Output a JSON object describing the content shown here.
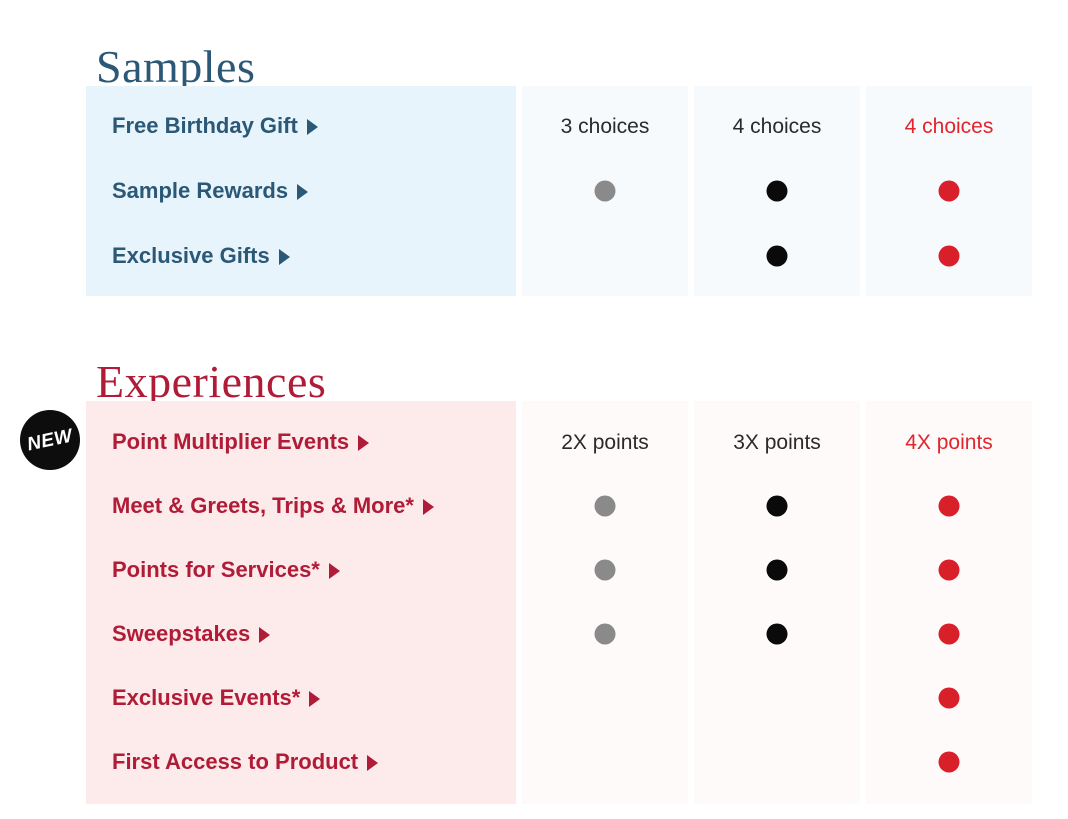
{
  "colors": {
    "samples_accent": "#2a5876",
    "experiences_accent": "#b01c37",
    "samples_label_bg": "#e8f4fb",
    "samples_data_bg": "#f6fafd",
    "experiences_label_bg": "#fdeaea",
    "experiences_data_bg": "#fdfaf9",
    "dot_grey": "#8a8a8a",
    "dot_black": "#0a0a0a",
    "dot_red": "#d81f2a",
    "header_text": "#2a2a2a",
    "header_text_highlight": "#e0262c"
  },
  "badge": {
    "label": "NEW",
    "name": "new-badge"
  },
  "sections": [
    {
      "id": "samples",
      "heading": "Samples",
      "columns": [
        {
          "header": "3 choices",
          "highlight": false,
          "dot_color": "#8a8a8a"
        },
        {
          "header": "4 choices",
          "highlight": false,
          "dot_color": "#0a0a0a"
        },
        {
          "header": "4 choices",
          "highlight": true,
          "dot_color": "#d81f2a"
        }
      ],
      "rows": [
        {
          "label": "Free Birthday Gift",
          "is_header_row": true,
          "dots": [
            false,
            false,
            false
          ]
        },
        {
          "label": "Sample Rewards",
          "is_header_row": false,
          "dots": [
            true,
            true,
            true
          ]
        },
        {
          "label": "Exclusive Gifts",
          "is_header_row": false,
          "dots": [
            false,
            true,
            true
          ]
        }
      ]
    },
    {
      "id": "experiences",
      "heading": "Experiences",
      "columns": [
        {
          "header": "2X points",
          "highlight": false,
          "dot_color": "#8a8a8a"
        },
        {
          "header": "3X points",
          "highlight": false,
          "dot_color": "#0a0a0a"
        },
        {
          "header": "4X points",
          "highlight": true,
          "dot_color": "#d81f2a"
        }
      ],
      "rows": [
        {
          "label": "Point Multiplier Events",
          "is_header_row": true,
          "dots": [
            false,
            false,
            false
          ]
        },
        {
          "label": "Meet & Greets, Trips & More*",
          "is_header_row": false,
          "dots": [
            true,
            true,
            true
          ]
        },
        {
          "label": "Points for Services*",
          "is_header_row": false,
          "dots": [
            true,
            true,
            true
          ]
        },
        {
          "label": "Sweepstakes",
          "is_header_row": false,
          "dots": [
            true,
            true,
            true
          ]
        },
        {
          "label": "Exclusive Events*",
          "is_header_row": false,
          "dots": [
            false,
            false,
            true
          ]
        },
        {
          "label": "First Access to Product",
          "is_header_row": false,
          "dots": [
            false,
            false,
            true
          ]
        }
      ]
    }
  ]
}
